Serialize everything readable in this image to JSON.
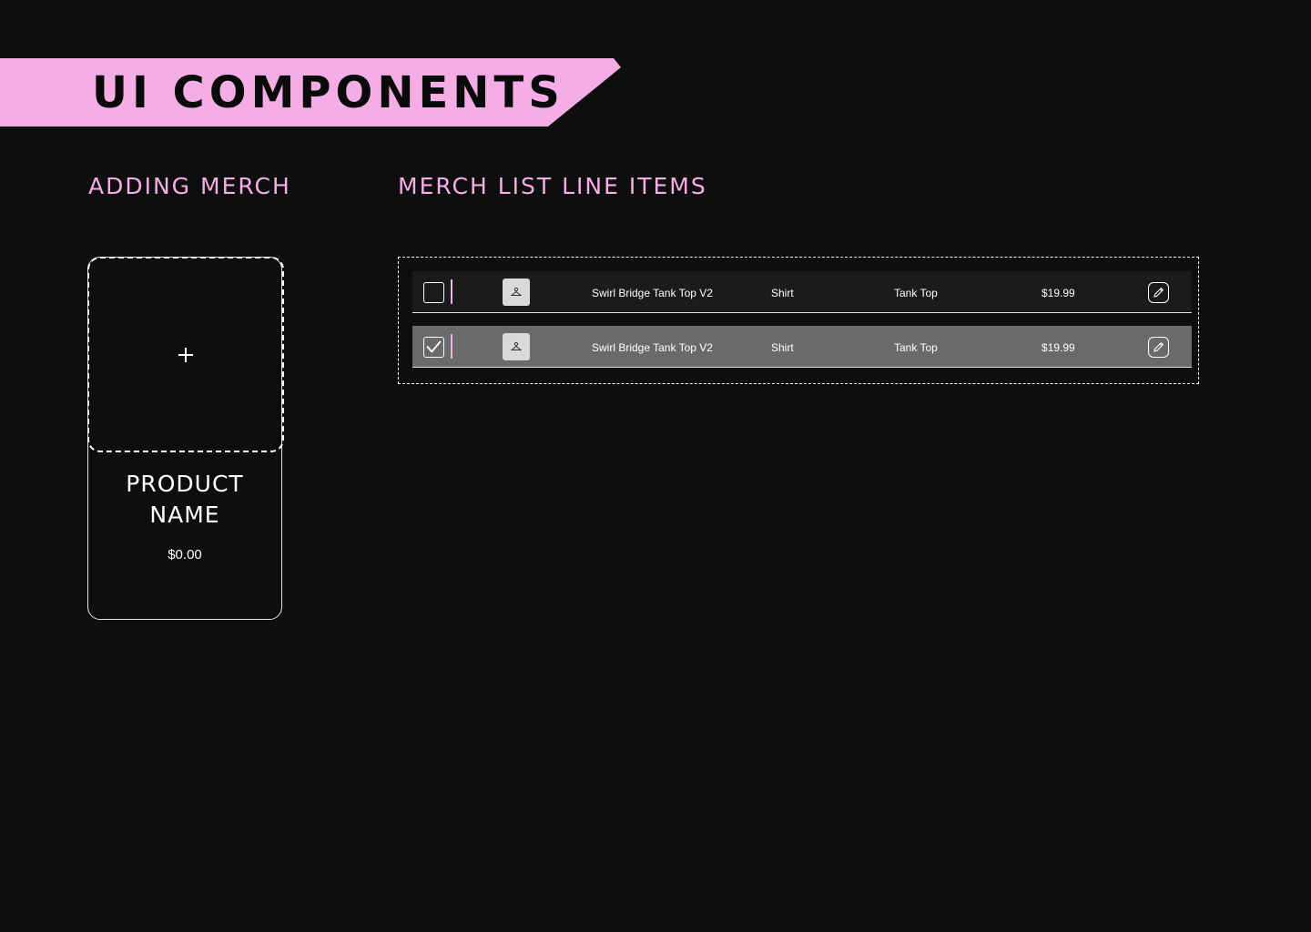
{
  "header": {
    "title": "UI COMPONENTS"
  },
  "sections": {
    "adding": {
      "heading": "ADDING MERCH"
    },
    "list": {
      "heading": "MERCH LIST LINE ITEMS"
    }
  },
  "add_card": {
    "product_name": "PRODUCT NAME",
    "price": "$0.00",
    "add_icon": "plus-icon"
  },
  "line_items": [
    {
      "checked": false,
      "name": "Swirl Bridge Tank Top V2",
      "category": "Shirt",
      "type": "Tank Top",
      "price": "$19.99",
      "thumbnail_icon": "hanger-icon",
      "action_icon": "pencil-icon"
    },
    {
      "checked": true,
      "name": "Swirl Bridge Tank Top V2",
      "category": "Shirt",
      "type": "Tank Top",
      "price": "$19.99",
      "thumbnail_icon": "hanger-icon",
      "action_icon": "pencil-icon"
    }
  ],
  "colors": {
    "background": "#0e0e0e",
    "accent_pink": "#f5aee5",
    "row_default": "#1b1b1b",
    "row_selected": "#6a6a6a"
  }
}
